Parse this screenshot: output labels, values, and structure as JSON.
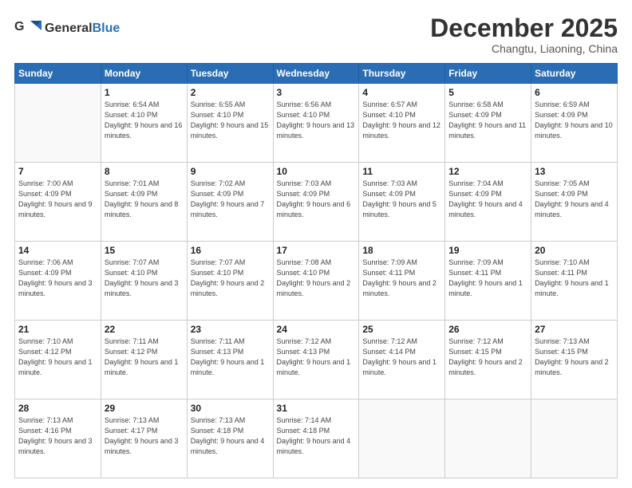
{
  "header": {
    "logo_general": "General",
    "logo_blue": "Blue",
    "month_title": "December 2025",
    "location": "Changtu, Liaoning, China"
  },
  "weekdays": [
    "Sunday",
    "Monday",
    "Tuesday",
    "Wednesday",
    "Thursday",
    "Friday",
    "Saturday"
  ],
  "weeks": [
    [
      {
        "day": "",
        "sunrise": "",
        "sunset": "",
        "daylight": ""
      },
      {
        "day": "1",
        "sunrise": "Sunrise: 6:54 AM",
        "sunset": "Sunset: 4:10 PM",
        "daylight": "Daylight: 9 hours and 16 minutes."
      },
      {
        "day": "2",
        "sunrise": "Sunrise: 6:55 AM",
        "sunset": "Sunset: 4:10 PM",
        "daylight": "Daylight: 9 hours and 15 minutes."
      },
      {
        "day": "3",
        "sunrise": "Sunrise: 6:56 AM",
        "sunset": "Sunset: 4:10 PM",
        "daylight": "Daylight: 9 hours and 13 minutes."
      },
      {
        "day": "4",
        "sunrise": "Sunrise: 6:57 AM",
        "sunset": "Sunset: 4:10 PM",
        "daylight": "Daylight: 9 hours and 12 minutes."
      },
      {
        "day": "5",
        "sunrise": "Sunrise: 6:58 AM",
        "sunset": "Sunset: 4:09 PM",
        "daylight": "Daylight: 9 hours and 11 minutes."
      },
      {
        "day": "6",
        "sunrise": "Sunrise: 6:59 AM",
        "sunset": "Sunset: 4:09 PM",
        "daylight": "Daylight: 9 hours and 10 minutes."
      }
    ],
    [
      {
        "day": "7",
        "sunrise": "Sunrise: 7:00 AM",
        "sunset": "Sunset: 4:09 PM",
        "daylight": "Daylight: 9 hours and 9 minutes."
      },
      {
        "day": "8",
        "sunrise": "Sunrise: 7:01 AM",
        "sunset": "Sunset: 4:09 PM",
        "daylight": "Daylight: 9 hours and 8 minutes."
      },
      {
        "day": "9",
        "sunrise": "Sunrise: 7:02 AM",
        "sunset": "Sunset: 4:09 PM",
        "daylight": "Daylight: 9 hours and 7 minutes."
      },
      {
        "day": "10",
        "sunrise": "Sunrise: 7:03 AM",
        "sunset": "Sunset: 4:09 PM",
        "daylight": "Daylight: 9 hours and 6 minutes."
      },
      {
        "day": "11",
        "sunrise": "Sunrise: 7:03 AM",
        "sunset": "Sunset: 4:09 PM",
        "daylight": "Daylight: 9 hours and 5 minutes."
      },
      {
        "day": "12",
        "sunrise": "Sunrise: 7:04 AM",
        "sunset": "Sunset: 4:09 PM",
        "daylight": "Daylight: 9 hours and 4 minutes."
      },
      {
        "day": "13",
        "sunrise": "Sunrise: 7:05 AM",
        "sunset": "Sunset: 4:09 PM",
        "daylight": "Daylight: 9 hours and 4 minutes."
      }
    ],
    [
      {
        "day": "14",
        "sunrise": "Sunrise: 7:06 AM",
        "sunset": "Sunset: 4:09 PM",
        "daylight": "Daylight: 9 hours and 3 minutes."
      },
      {
        "day": "15",
        "sunrise": "Sunrise: 7:07 AM",
        "sunset": "Sunset: 4:10 PM",
        "daylight": "Daylight: 9 hours and 3 minutes."
      },
      {
        "day": "16",
        "sunrise": "Sunrise: 7:07 AM",
        "sunset": "Sunset: 4:10 PM",
        "daylight": "Daylight: 9 hours and 2 minutes."
      },
      {
        "day": "17",
        "sunrise": "Sunrise: 7:08 AM",
        "sunset": "Sunset: 4:10 PM",
        "daylight": "Daylight: 9 hours and 2 minutes."
      },
      {
        "day": "18",
        "sunrise": "Sunrise: 7:09 AM",
        "sunset": "Sunset: 4:11 PM",
        "daylight": "Daylight: 9 hours and 2 minutes."
      },
      {
        "day": "19",
        "sunrise": "Sunrise: 7:09 AM",
        "sunset": "Sunset: 4:11 PM",
        "daylight": "Daylight: 9 hours and 1 minute."
      },
      {
        "day": "20",
        "sunrise": "Sunrise: 7:10 AM",
        "sunset": "Sunset: 4:11 PM",
        "daylight": "Daylight: 9 hours and 1 minute."
      }
    ],
    [
      {
        "day": "21",
        "sunrise": "Sunrise: 7:10 AM",
        "sunset": "Sunset: 4:12 PM",
        "daylight": "Daylight: 9 hours and 1 minute."
      },
      {
        "day": "22",
        "sunrise": "Sunrise: 7:11 AM",
        "sunset": "Sunset: 4:12 PM",
        "daylight": "Daylight: 9 hours and 1 minute."
      },
      {
        "day": "23",
        "sunrise": "Sunrise: 7:11 AM",
        "sunset": "Sunset: 4:13 PM",
        "daylight": "Daylight: 9 hours and 1 minute."
      },
      {
        "day": "24",
        "sunrise": "Sunrise: 7:12 AM",
        "sunset": "Sunset: 4:13 PM",
        "daylight": "Daylight: 9 hours and 1 minute."
      },
      {
        "day": "25",
        "sunrise": "Sunrise: 7:12 AM",
        "sunset": "Sunset: 4:14 PM",
        "daylight": "Daylight: 9 hours and 1 minute."
      },
      {
        "day": "26",
        "sunrise": "Sunrise: 7:12 AM",
        "sunset": "Sunset: 4:15 PM",
        "daylight": "Daylight: 9 hours and 2 minutes."
      },
      {
        "day": "27",
        "sunrise": "Sunrise: 7:13 AM",
        "sunset": "Sunset: 4:15 PM",
        "daylight": "Daylight: 9 hours and 2 minutes."
      }
    ],
    [
      {
        "day": "28",
        "sunrise": "Sunrise: 7:13 AM",
        "sunset": "Sunset: 4:16 PM",
        "daylight": "Daylight: 9 hours and 3 minutes."
      },
      {
        "day": "29",
        "sunrise": "Sunrise: 7:13 AM",
        "sunset": "Sunset: 4:17 PM",
        "daylight": "Daylight: 9 hours and 3 minutes."
      },
      {
        "day": "30",
        "sunrise": "Sunrise: 7:13 AM",
        "sunset": "Sunset: 4:18 PM",
        "daylight": "Daylight: 9 hours and 4 minutes."
      },
      {
        "day": "31",
        "sunrise": "Sunrise: 7:14 AM",
        "sunset": "Sunset: 4:18 PM",
        "daylight": "Daylight: 9 hours and 4 minutes."
      },
      {
        "day": "",
        "sunrise": "",
        "sunset": "",
        "daylight": ""
      },
      {
        "day": "",
        "sunrise": "",
        "sunset": "",
        "daylight": ""
      },
      {
        "day": "",
        "sunrise": "",
        "sunset": "",
        "daylight": ""
      }
    ]
  ]
}
